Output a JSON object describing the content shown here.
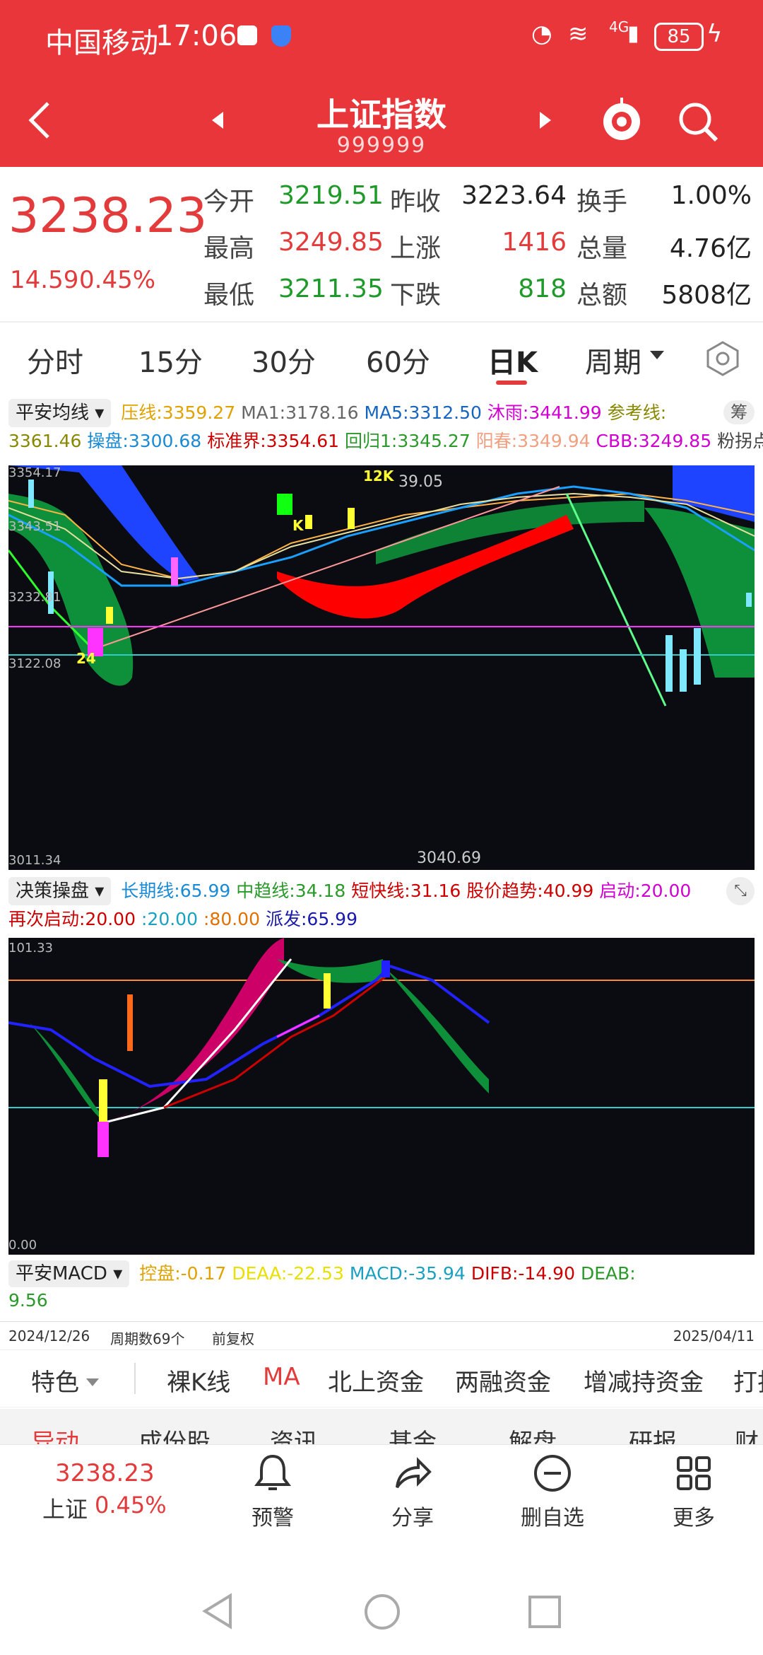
{
  "status": {
    "carrier": "中国移动",
    "time": "17:06",
    "network": "4G",
    "battery": "85"
  },
  "header": {
    "title": "上证指数",
    "code": "999999"
  },
  "quote": {
    "price": "3238.23",
    "change": "14.59",
    "change_pct": "0.45%",
    "rows": [
      {
        "l1": "今开",
        "v1": "3219.51",
        "l2": "昨收",
        "v2": "3223.64",
        "l3": "换手",
        "v3": "1.00%"
      },
      {
        "l1": "最高",
        "v1": "3249.85",
        "l2": "上涨",
        "v2": "1416",
        "l3": "总量",
        "v3": "4.76亿"
      },
      {
        "l1": "最低",
        "v1": "3211.35",
        "l2": "下跌",
        "v2": "818",
        "l3": "总额",
        "v3": "5808亿"
      }
    ]
  },
  "tabs": [
    "分时",
    "15分",
    "30分",
    "60分",
    "日K",
    "周期"
  ],
  "indicator1": {
    "name": "平安均线",
    "badge": "筹",
    "line1": [
      {
        "t": "压线:3359.27",
        "c": "#e0a200"
      },
      {
        "t": "MA1:3178.16",
        "c": "#666"
      },
      {
        "t": "MA5:3312.50",
        "c": "#1565c0"
      },
      {
        "t": "沐雨:3441.99",
        "c": "#d000d0"
      },
      {
        "t": "参考线:",
        "c": "#888800"
      }
    ],
    "line2": [
      {
        "t": "3361.46",
        "c": "#888800"
      },
      {
        "t": "操盘:3300.68",
        "c": "#1a8ad4"
      },
      {
        "t": "标准界:3354.61",
        "c": "#cc0000"
      },
      {
        "t": "回归1:3345.27",
        "c": "#2a9a2a"
      },
      {
        "t": "阳春:3349.94",
        "c": "#f0a080"
      },
      {
        "t": "CBB:3249.85",
        "c": "#d000d0"
      },
      {
        "t": "粉拐点:",
        "c": "#444"
      }
    ]
  },
  "main_chart": {
    "y_labels": [
      "3354.17",
      "3343.51",
      "3232.81",
      "3122.08",
      "3011.34"
    ],
    "annotations": {
      "high": "39.05",
      "low": "3040.69",
      "mark_24": "24",
      "mark_12k": "12K",
      "mark_k": "K"
    }
  },
  "indicator2": {
    "name": "决策操盘",
    "line1": [
      {
        "t": "长期线:65.99",
        "c": "#1a8ad4"
      },
      {
        "t": "中趋线:34.18",
        "c": "#2a9a2a"
      },
      {
        "t": "短快线:31.16",
        "c": "#cc0000"
      },
      {
        "t": "股价趋势:40.99",
        "c": "#cc0000"
      },
      {
        "t": "启动:20.00",
        "c": "#d000d0"
      }
    ],
    "line2": [
      {
        "t": "再次启动:20.00",
        "c": "#cc0000"
      },
      {
        "t": ":20.00",
        "c": "#1aa0c0"
      },
      {
        "t": ":80.00",
        "c": "#e07000"
      },
      {
        "t": "派发:65.99",
        "c": "#1a1aaa"
      }
    ]
  },
  "sub_chart": {
    "y_top": "101.33",
    "y_bottom": "0.00"
  },
  "indicator3": {
    "name": "平安MACD",
    "line1": [
      {
        "t": "控盘:-0.17",
        "c": "#e0a200"
      },
      {
        "t": "DEAA:-22.53",
        "c": "#e8e000"
      },
      {
        "t": "MACD:-35.94",
        "c": "#1aa0c0"
      },
      {
        "t": "DIFB:-14.90",
        "c": "#cc0000"
      },
      {
        "t": "DEAB:",
        "c": "#2a9a2a"
      }
    ],
    "line2": [
      {
        "t": "9.56",
        "c": "#2a9a2a"
      }
    ]
  },
  "dates": {
    "start": "2024/12/26",
    "periods": "周期数69个",
    "adjust": "前复权",
    "end": "2025/04/11"
  },
  "features": [
    "特色",
    "裸K线",
    "MA",
    "北上资金",
    "两融资金",
    "增减持资金",
    "打折"
  ],
  "bottom_tabs_peek": [
    "异动",
    "成份股",
    "资讯",
    "基金",
    "解盘",
    "研报",
    "财务"
  ],
  "bottom_nav": {
    "price": "3238.23",
    "name": "上证",
    "pct": "0.45%",
    "items": [
      "预警",
      "分享",
      "删自选",
      "更多"
    ]
  },
  "colors": {
    "brand": "#e8363a",
    "up": "#e33b3b",
    "down": "#1f9a2a"
  }
}
